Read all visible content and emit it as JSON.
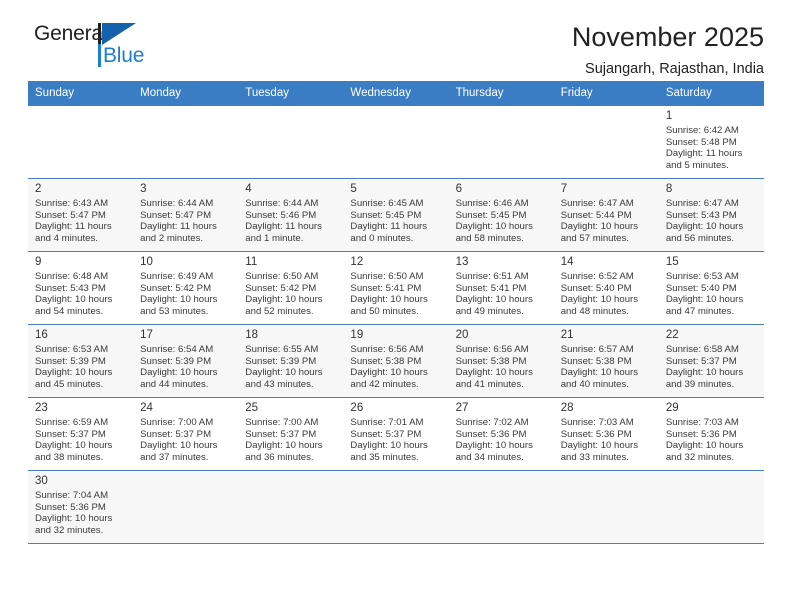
{
  "brand": {
    "name_top": "General",
    "name_bottom": "Blue",
    "accent_color": "#1c7fd0",
    "flag_color": "#1461ad"
  },
  "header": {
    "title": "November 2025",
    "subtitle": "Sujangarh, Rajasthan, India"
  },
  "calendar": {
    "header_bg": "#3b7dc4",
    "weekday_headers": [
      "Sunday",
      "Monday",
      "Tuesday",
      "Wednesday",
      "Thursday",
      "Friday",
      "Saturday"
    ],
    "weeks": [
      [
        {
          "day": "",
          "info": ""
        },
        {
          "day": "",
          "info": ""
        },
        {
          "day": "",
          "info": ""
        },
        {
          "day": "",
          "info": ""
        },
        {
          "day": "",
          "info": ""
        },
        {
          "day": "",
          "info": ""
        },
        {
          "day": "1",
          "info": "Sunrise: 6:42 AM\nSunset: 5:48 PM\nDaylight: 11 hours\nand 5 minutes."
        }
      ],
      [
        {
          "day": "2",
          "info": "Sunrise: 6:43 AM\nSunset: 5:47 PM\nDaylight: 11 hours\nand 4 minutes."
        },
        {
          "day": "3",
          "info": "Sunrise: 6:44 AM\nSunset: 5:47 PM\nDaylight: 11 hours\nand 2 minutes."
        },
        {
          "day": "4",
          "info": "Sunrise: 6:44 AM\nSunset: 5:46 PM\nDaylight: 11 hours\nand 1 minute."
        },
        {
          "day": "5",
          "info": "Sunrise: 6:45 AM\nSunset: 5:45 PM\nDaylight: 11 hours\nand 0 minutes."
        },
        {
          "day": "6",
          "info": "Sunrise: 6:46 AM\nSunset: 5:45 PM\nDaylight: 10 hours\nand 58 minutes."
        },
        {
          "day": "7",
          "info": "Sunrise: 6:47 AM\nSunset: 5:44 PM\nDaylight: 10 hours\nand 57 minutes."
        },
        {
          "day": "8",
          "info": "Sunrise: 6:47 AM\nSunset: 5:43 PM\nDaylight: 10 hours\nand 56 minutes."
        }
      ],
      [
        {
          "day": "9",
          "info": "Sunrise: 6:48 AM\nSunset: 5:43 PM\nDaylight: 10 hours\nand 54 minutes."
        },
        {
          "day": "10",
          "info": "Sunrise: 6:49 AM\nSunset: 5:42 PM\nDaylight: 10 hours\nand 53 minutes."
        },
        {
          "day": "11",
          "info": "Sunrise: 6:50 AM\nSunset: 5:42 PM\nDaylight: 10 hours\nand 52 minutes."
        },
        {
          "day": "12",
          "info": "Sunrise: 6:50 AM\nSunset: 5:41 PM\nDaylight: 10 hours\nand 50 minutes."
        },
        {
          "day": "13",
          "info": "Sunrise: 6:51 AM\nSunset: 5:41 PM\nDaylight: 10 hours\nand 49 minutes."
        },
        {
          "day": "14",
          "info": "Sunrise: 6:52 AM\nSunset: 5:40 PM\nDaylight: 10 hours\nand 48 minutes."
        },
        {
          "day": "15",
          "info": "Sunrise: 6:53 AM\nSunset: 5:40 PM\nDaylight: 10 hours\nand 47 minutes."
        }
      ],
      [
        {
          "day": "16",
          "info": "Sunrise: 6:53 AM\nSunset: 5:39 PM\nDaylight: 10 hours\nand 45 minutes."
        },
        {
          "day": "17",
          "info": "Sunrise: 6:54 AM\nSunset: 5:39 PM\nDaylight: 10 hours\nand 44 minutes."
        },
        {
          "day": "18",
          "info": "Sunrise: 6:55 AM\nSunset: 5:39 PM\nDaylight: 10 hours\nand 43 minutes."
        },
        {
          "day": "19",
          "info": "Sunrise: 6:56 AM\nSunset: 5:38 PM\nDaylight: 10 hours\nand 42 minutes."
        },
        {
          "day": "20",
          "info": "Sunrise: 6:56 AM\nSunset: 5:38 PM\nDaylight: 10 hours\nand 41 minutes."
        },
        {
          "day": "21",
          "info": "Sunrise: 6:57 AM\nSunset: 5:38 PM\nDaylight: 10 hours\nand 40 minutes."
        },
        {
          "day": "22",
          "info": "Sunrise: 6:58 AM\nSunset: 5:37 PM\nDaylight: 10 hours\nand 39 minutes."
        }
      ],
      [
        {
          "day": "23",
          "info": "Sunrise: 6:59 AM\nSunset: 5:37 PM\nDaylight: 10 hours\nand 38 minutes."
        },
        {
          "day": "24",
          "info": "Sunrise: 7:00 AM\nSunset: 5:37 PM\nDaylight: 10 hours\nand 37 minutes."
        },
        {
          "day": "25",
          "info": "Sunrise: 7:00 AM\nSunset: 5:37 PM\nDaylight: 10 hours\nand 36 minutes."
        },
        {
          "day": "26",
          "info": "Sunrise: 7:01 AM\nSunset: 5:37 PM\nDaylight: 10 hours\nand 35 minutes."
        },
        {
          "day": "27",
          "info": "Sunrise: 7:02 AM\nSunset: 5:36 PM\nDaylight: 10 hours\nand 34 minutes."
        },
        {
          "day": "28",
          "info": "Sunrise: 7:03 AM\nSunset: 5:36 PM\nDaylight: 10 hours\nand 33 minutes."
        },
        {
          "day": "29",
          "info": "Sunrise: 7:03 AM\nSunset: 5:36 PM\nDaylight: 10 hours\nand 32 minutes."
        }
      ],
      [
        {
          "day": "30",
          "info": "Sunrise: 7:04 AM\nSunset: 5:36 PM\nDaylight: 10 hours\nand 32 minutes."
        },
        {
          "day": "",
          "info": ""
        },
        {
          "day": "",
          "info": ""
        },
        {
          "day": "",
          "info": ""
        },
        {
          "day": "",
          "info": ""
        },
        {
          "day": "",
          "info": ""
        },
        {
          "day": "",
          "info": ""
        }
      ]
    ]
  }
}
